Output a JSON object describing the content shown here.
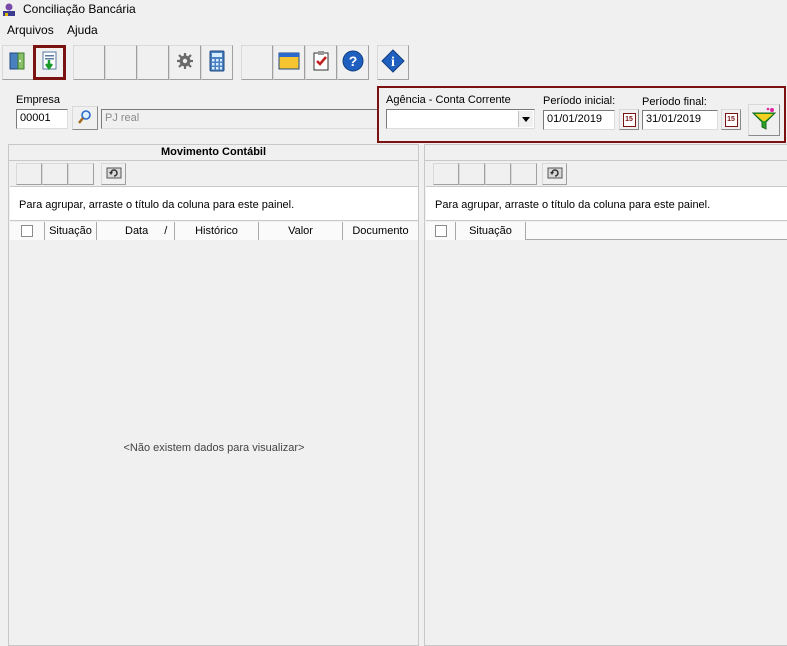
{
  "window": {
    "title": "Conciliação Bancária"
  },
  "menu": {
    "items": [
      {
        "label": "Arquivos"
      },
      {
        "label": "Ajuda"
      }
    ]
  },
  "empresa": {
    "label": "Empresa",
    "code": "00001",
    "name_placeholder": "PJ real"
  },
  "filter": {
    "agencia_label": "Agência - Conta Corrente",
    "agencia_value": "",
    "periodo_inicial_label": "Período inicial:",
    "periodo_inicial_value": "01/01/2019",
    "periodo_final_label": "Período final:",
    "periodo_final_value": "31/01/2019",
    "calendar_label": "15"
  },
  "left_panel": {
    "title": "Movimento Contábil",
    "group_hint": "Para agrupar, arraste o título da coluna para este painel.",
    "columns": [
      "Situação",
      "Data",
      "/",
      "Histórico",
      "Valor",
      "Documento"
    ],
    "empty_message": "<Não existem dados para visualizar>"
  },
  "right_panel": {
    "group_hint": "Para agrupar, arraste o título da coluna para este painel.",
    "columns": [
      "Situação"
    ]
  },
  "icons": {
    "app": "app-icon",
    "exit": "exit-door-icon",
    "import": "import-document-icon",
    "settings": "settings-gear-icon",
    "calculator": "calculator-icon",
    "window": "window-icon",
    "clipboard": "clipboard-check-icon",
    "help": "help-icon",
    "info": "info-icon",
    "search": "search-icon",
    "filter": "filter-funnel-icon",
    "refresh": "refresh-icon"
  },
  "colors": {
    "highlight": "#7a1212",
    "help_blue": "#1f5fbf"
  }
}
